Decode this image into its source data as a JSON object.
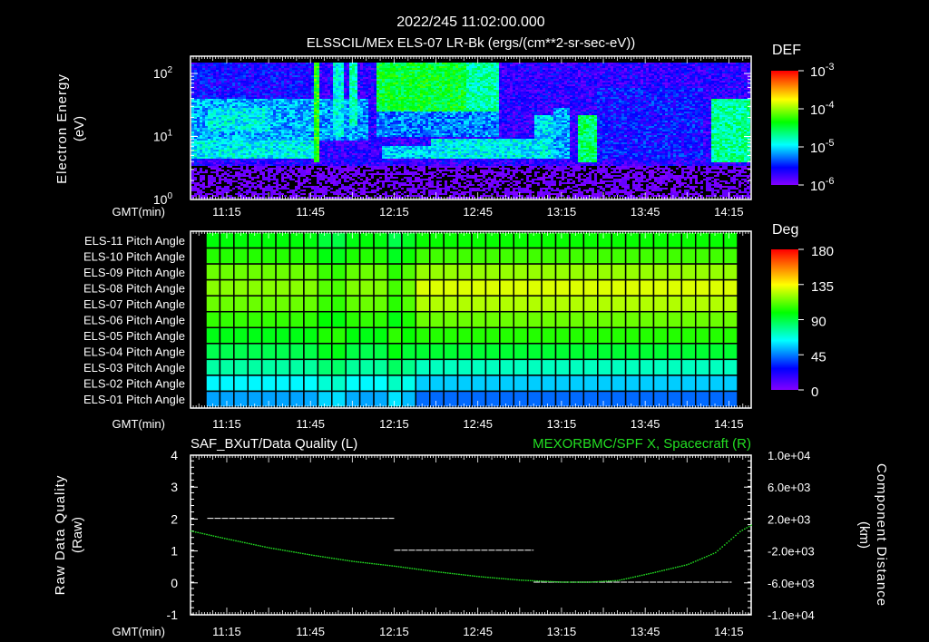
{
  "header": {
    "timestamp": "2022/245 11:02:00.000",
    "title": "ELSSCIL/MEx ELS-07 LR-Bk  (ergs/(cm**2-sr-sec-eV))"
  },
  "time_axis": {
    "label": "GMT(min)",
    "ticks": [
      "11:15",
      "11:45",
      "12:15",
      "12:45",
      "13:15",
      "13:45",
      "14:15"
    ],
    "tick_minutes": [
      675,
      705,
      735,
      765,
      795,
      825,
      855
    ],
    "range_minutes": [
      662,
      863
    ]
  },
  "chart_data": [
    {
      "type": "heatmap",
      "name": "energy-spectrogram",
      "ylabel_line1": "Electron Energy",
      "ylabel_line2": "(eV)",
      "yscale": "log",
      "ylim": [
        1,
        185
      ],
      "yticks": [
        {
          "base": "10",
          "exp": "0",
          "value": 1
        },
        {
          "base": "10",
          "exp": "1",
          "value": 10
        },
        {
          "base": "10",
          "exp": "2",
          "value": 100
        }
      ],
      "colorbar": {
        "title": "DEF",
        "scale": "log",
        "range_log10": [
          -6,
          -3
        ],
        "labels": [
          {
            "base": "10",
            "exp": "-3"
          },
          {
            "base": "10",
            "exp": "-4"
          },
          {
            "base": "10",
            "exp": "-5"
          },
          {
            "base": "10",
            "exp": "-6"
          }
        ]
      },
      "background_log10_def": {
        "low_energy_below_eV": 3.5,
        "low": -6.3,
        "high": -5.7
      },
      "regions_log10_def": [
        {
          "t": [
            662,
            707
          ],
          "e": [
            4.5,
            9
          ],
          "v": -4.95
        },
        {
          "t": [
            662,
            707
          ],
          "e": [
            9,
            40
          ],
          "v": -5.15
        },
        {
          "t": [
            668,
            690
          ],
          "e": [
            12,
            30
          ],
          "v": -4.95
        },
        {
          "t": [
            662,
            707
          ],
          "e": [
            40,
            185
          ],
          "v": -5.6
        },
        {
          "t": [
            706,
            708
          ],
          "e": [
            4,
            185
          ],
          "v": -4.3
        },
        {
          "t": [
            713,
            716
          ],
          "e": [
            10,
            185
          ],
          "v": -4.9
        },
        {
          "t": [
            718,
            721
          ],
          "e": [
            15,
            185
          ],
          "v": -4.8
        },
        {
          "t": [
            707,
            725
          ],
          "e": [
            9,
            40
          ],
          "v": -5.2
        },
        {
          "t": [
            728,
            760
          ],
          "e": [
            25,
            185
          ],
          "v": -4.45
        },
        {
          "t": [
            760,
            772
          ],
          "e": [
            25,
            185
          ],
          "v": -4.75
        },
        {
          "t": [
            728,
            772
          ],
          "e": [
            10,
            25
          ],
          "v": -5.25
        },
        {
          "t": [
            730,
            748
          ],
          "e": [
            4.5,
            7.5
          ],
          "v": -5.05
        },
        {
          "t": [
            748,
            790
          ],
          "e": [
            4.5,
            9.5
          ],
          "v": -4.95
        },
        {
          "t": [
            785,
            792
          ],
          "e": [
            4.5,
            22
          ],
          "v": -5.0
        },
        {
          "t": [
            792,
            797
          ],
          "e": [
            4.5,
            30
          ],
          "v": -5.15
        },
        {
          "t": [
            800,
            807
          ],
          "e": [
            4,
            22
          ],
          "v": -4.6
        },
        {
          "t": [
            807,
            845
          ],
          "e": [
            4.5,
            60
          ],
          "v": -5.55
        },
        {
          "t": [
            848,
            863
          ],
          "e": [
            4,
            40
          ],
          "v": -4.7
        }
      ]
    },
    {
      "type": "heatmap",
      "name": "pitch-angle",
      "colorbar": {
        "title": "Deg",
        "range": [
          0,
          180
        ],
        "labels": [
          "180",
          "135",
          "90",
          "45",
          "0"
        ]
      },
      "rows": [
        "ELS-11 Pitch Angle",
        "ELS-10 Pitch Angle",
        "ELS-09 Pitch Angle",
        "ELS-08 Pitch Angle",
        "ELS-07 Pitch Angle",
        "ELS-06 Pitch Angle",
        "ELS-05 Pitch Angle",
        "ELS-04 Pitch Angle",
        "ELS-03 Pitch Angle",
        "ELS-02 Pitch Angle",
        "ELS-01 Pitch Angle"
      ],
      "row_base_deg": [
        100,
        108,
        120,
        130,
        124,
        114,
        104,
        92,
        72,
        56,
        42
      ],
      "row_early_deg": [
        98,
        104,
        114,
        118,
        114,
        106,
        96,
        88,
        76,
        62,
        50
      ],
      "early_until_minute": 740,
      "column_start_minute": 668,
      "column_step_minutes": 5,
      "column_count": 38,
      "dips": [
        {
          "center": 711,
          "width": 5
        },
        {
          "center": 734,
          "width": 4
        }
      ]
    },
    {
      "type": "line",
      "name": "data-quality-and-position",
      "left_title": "SAF_BXuT/Data Quality (L)",
      "right_title": "MEXORBMC/SPF X, Spacecraft (R)",
      "ylabel_left_line1": "Raw Data Quality",
      "ylabel_left_line2": "(Raw)",
      "ylabel_right_line1": "Component Distance",
      "ylabel_right_line2": "(km)",
      "ylim_left": [
        -1,
        4
      ],
      "yticks_left": [
        "4",
        "3",
        "2",
        "1",
        "0",
        "-1"
      ],
      "ylim_right": [
        -10000,
        10000
      ],
      "yticks_right": [
        "1.0e+04",
        "6.0e+03",
        "2.0e+03",
        "-2.0e+03",
        "-6.0e+03",
        "-1.0e+04"
      ],
      "data_quality_segments": [
        {
          "t": [
            668,
            735
          ],
          "value": 2
        },
        {
          "t": [
            735,
            785
          ],
          "value": 1
        },
        {
          "t": [
            785,
            856
          ],
          "value": 0
        }
      ],
      "spf_x_km": {
        "t": [
          662,
          675,
          690,
          705,
          720,
          735,
          750,
          765,
          780,
          795,
          805,
          815,
          828,
          840,
          850,
          859,
          863
        ],
        "v": [
          400,
          -600,
          -1700,
          -2600,
          -3400,
          -4000,
          -4700,
          -5300,
          -5750,
          -6000,
          -6000,
          -5800,
          -4800,
          -3800,
          -2300,
          400,
          1160
        ]
      },
      "colors": {
        "quality": "#ffffff",
        "position": "#22dd22"
      }
    }
  ]
}
